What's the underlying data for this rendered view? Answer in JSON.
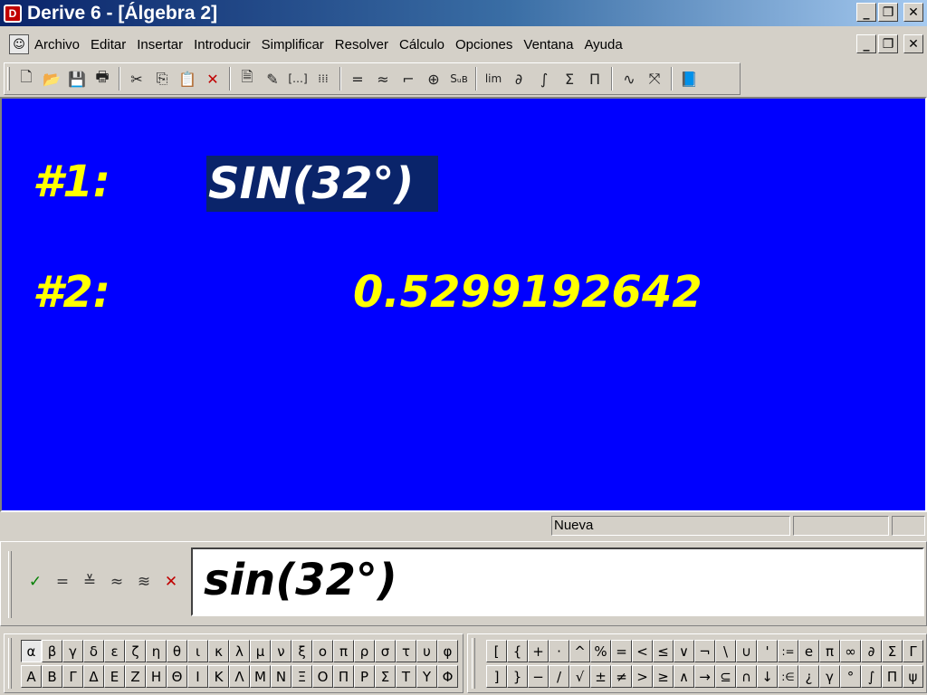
{
  "window": {
    "title": "Derive 6 - [Álgebra 2]",
    "app_icon": "derive-app-icon",
    "caption_buttons": [
      "_",
      "❐",
      "✕"
    ]
  },
  "menu": {
    "doc_icon": "algebra-doc-icon",
    "items": [
      "Archivo",
      "Editar",
      "Insertar",
      "Introducir",
      "Simplificar",
      "Resolver",
      "Cálculo",
      "Opciones",
      "Ventana",
      "Ayuda"
    ],
    "caption_buttons": [
      "_",
      "❐",
      "✕"
    ]
  },
  "toolbar": {
    "groups": [
      [
        {
          "icon": "new-file-icon",
          "glyph": "🗋"
        },
        {
          "icon": "open-folder-icon",
          "glyph": "📂"
        },
        {
          "icon": "save-icon",
          "glyph": "💾"
        },
        {
          "icon": "print-icon",
          "glyph": "🖶"
        }
      ],
      [
        {
          "icon": "cut-icon",
          "glyph": "✂"
        },
        {
          "icon": "copy-icon",
          "glyph": "⎘"
        },
        {
          "icon": "paste-icon",
          "glyph": "📋"
        },
        {
          "icon": "delete-icon",
          "glyph": "✕"
        }
      ],
      [
        {
          "icon": "insert-text-icon",
          "glyph": "🗎"
        },
        {
          "icon": "insert-note-icon",
          "glyph": "✎"
        },
        {
          "icon": "insert-vector-icon",
          "glyph": "[…]"
        },
        {
          "icon": "insert-matrix-icon",
          "glyph": "⁞⁞⁞"
        }
      ],
      [
        {
          "icon": "simplify-icon",
          "glyph": "="
        },
        {
          "icon": "approximate-icon",
          "glyph": "≈"
        },
        {
          "icon": "expand-icon",
          "glyph": "⌐"
        },
        {
          "icon": "factor-icon",
          "glyph": "⊕"
        },
        {
          "icon": "substitute-icon",
          "glyph": "Sᵤʙ"
        }
      ],
      [
        {
          "icon": "limit-icon",
          "glyph": "lim"
        },
        {
          "icon": "derivative-icon",
          "glyph": "∂"
        },
        {
          "icon": "integral-icon",
          "glyph": "∫"
        },
        {
          "icon": "sum-icon",
          "glyph": "Σ"
        },
        {
          "icon": "product-icon",
          "glyph": "Π"
        }
      ],
      [
        {
          "icon": "2d-plot-icon",
          "glyph": "∿"
        },
        {
          "icon": "3d-plot-icon",
          "glyph": "⤧"
        }
      ],
      [
        {
          "icon": "help-book-icon",
          "glyph": "📘"
        }
      ]
    ],
    "accent_color": "#c00000"
  },
  "algebra": {
    "background": "#0000ff",
    "label_color": "#ffff00",
    "selected_bg": "#0a246a",
    "expressions": [
      {
        "label": "#1:",
        "expr": "SIN(32°)"
      },
      {
        "label": "#2:",
        "expr": "0.5299192642"
      }
    ]
  },
  "status": {
    "mode": "Nueva",
    "cell2": "",
    "cell3": ""
  },
  "entry": {
    "buttons": [
      {
        "icon": "enter-check-icon",
        "glyph": "✓"
      },
      {
        "icon": "simplify-equals-icon",
        "glyph": "="
      },
      {
        "icon": "enter-simplify-icon",
        "glyph": "≚"
      },
      {
        "icon": "enter-approx-icon",
        "glyph": "≈"
      },
      {
        "icon": "approx-simplify-icon",
        "glyph": "≋"
      },
      {
        "icon": "cancel-icon",
        "glyph": "✕"
      }
    ],
    "value": "sin(32°)"
  },
  "greek_palette": {
    "row1": [
      "α",
      "β",
      "γ",
      "δ",
      "ε",
      "ζ",
      "η",
      "θ",
      "ι",
      "κ",
      "λ",
      "μ",
      "ν",
      "ξ",
      "ο",
      "π",
      "ρ",
      "σ",
      "τ",
      "υ",
      "φ"
    ],
    "row2": [
      "Α",
      "Β",
      "Γ",
      "Δ",
      "Ε",
      "Ζ",
      "Η",
      "Θ",
      "Ι",
      "Κ",
      "Λ",
      "Μ",
      "Ν",
      "Ξ",
      "Ο",
      "Π",
      "Ρ",
      "Σ",
      "Τ",
      "Υ",
      "Φ"
    ]
  },
  "math_palette": {
    "row1": [
      "[",
      "{",
      "+",
      "·",
      "^",
      "%",
      "=",
      "<",
      "≤",
      "∨",
      "¬",
      "\\",
      "∪",
      "'",
      ":=",
      "e",
      "π",
      "∞",
      "∂",
      "Σ",
      "Γ"
    ],
    "row2": [
      "]",
      "}",
      "−",
      "/",
      "√",
      "±",
      "≠",
      ">",
      "≥",
      "∧",
      "→",
      "⊆",
      "∩",
      "↓",
      ":∈",
      "¿",
      "γ",
      "°",
      "∫",
      "Π",
      "ψ"
    ]
  }
}
